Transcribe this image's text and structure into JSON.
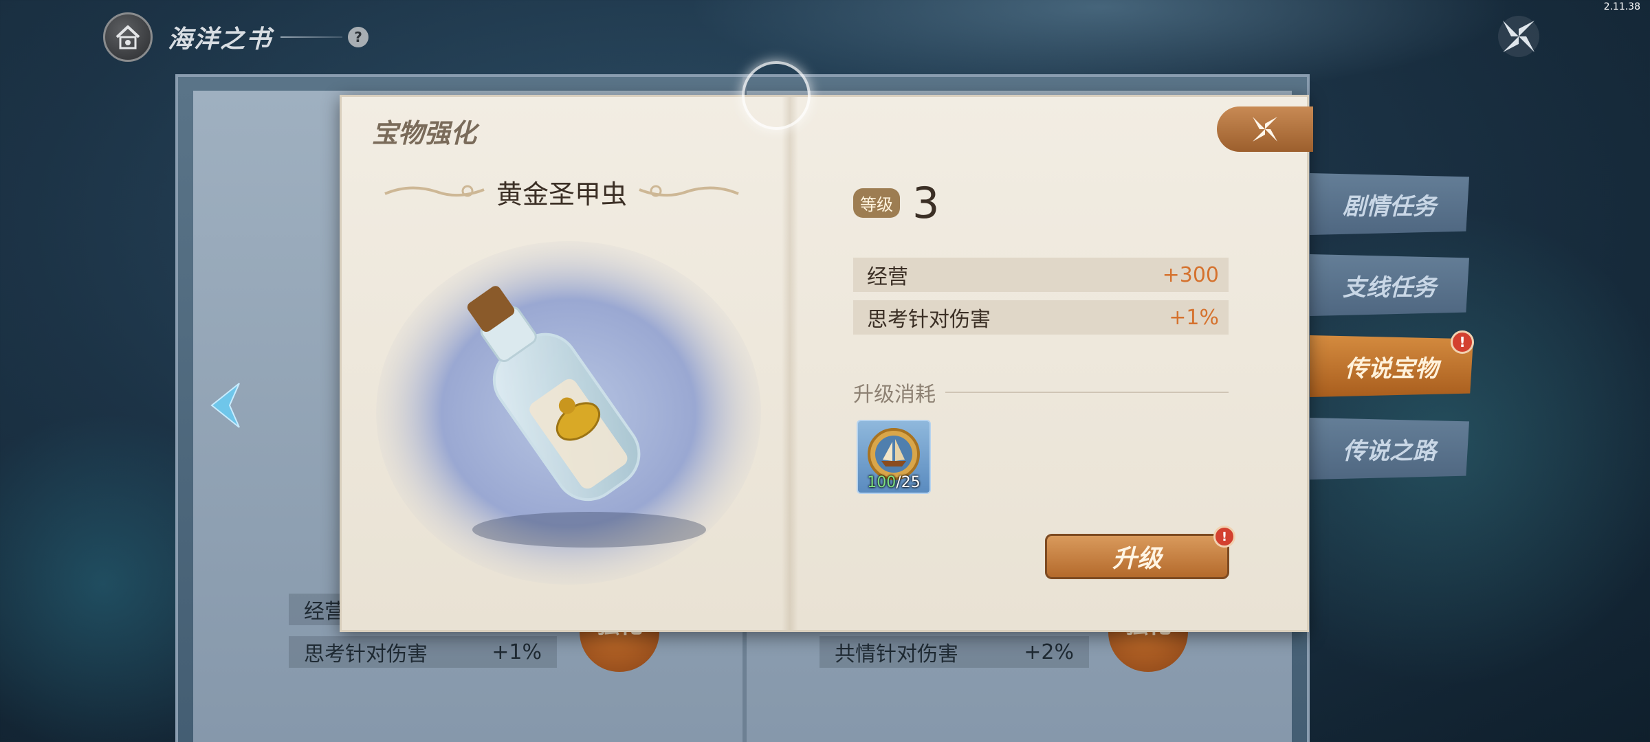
{
  "version": "2.11.38",
  "header": {
    "title": "海洋之书",
    "help": "?"
  },
  "tabs": [
    {
      "label": "剧情任务",
      "active": false
    },
    {
      "label": "支线任务",
      "active": false
    },
    {
      "label": "传说宝物",
      "active": true,
      "alert": "!"
    },
    {
      "label": "传说之路",
      "active": false
    }
  ],
  "background_cards": [
    {
      "stats": [
        {
          "name": "经营",
          "value": ""
        },
        {
          "name": "思考针对伤害",
          "value": "+1%"
        }
      ],
      "button": "强化"
    },
    {
      "stats": [
        {
          "name": "共情针对伤害",
          "value": "+2%"
        }
      ],
      "button": "强化"
    }
  ],
  "dialog": {
    "title": "宝物强化",
    "item_name": "黄金圣甲虫",
    "level_label": "等级",
    "level_value": "3",
    "stats": [
      {
        "name": "经营",
        "value": "+300"
      },
      {
        "name": "思考针对伤害",
        "value": "+1%"
      }
    ],
    "cost_label": "升级消耗",
    "cost_item": {
      "have": "100",
      "need": "/25"
    },
    "upgrade_label": "升级",
    "upgrade_alert": "!"
  },
  "colors": {
    "accent": "#d5722e",
    "tab_active": "#c47a33",
    "tab_inactive": "#5a7390",
    "paper": "#f2ede3"
  }
}
